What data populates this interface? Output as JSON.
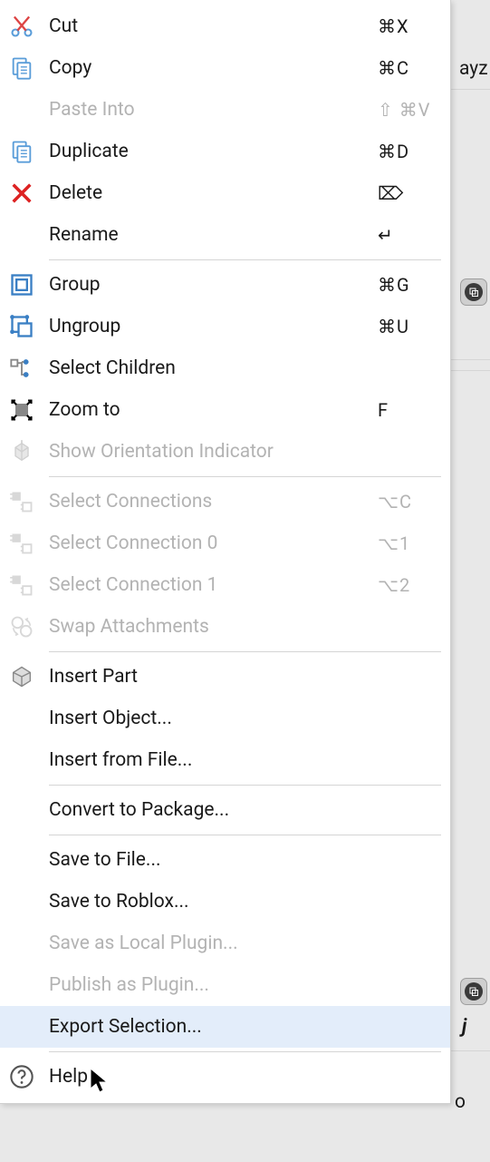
{
  "menu": {
    "groups": [
      [
        {
          "id": "cut",
          "label": "Cut",
          "shortcut": "⌘X",
          "icon": "cut-icon",
          "enabled": true
        },
        {
          "id": "copy",
          "label": "Copy",
          "shortcut": "⌘C",
          "icon": "copy-icon",
          "enabled": true
        },
        {
          "id": "paste-into",
          "label": "Paste Into",
          "shortcut": "⇧ ⌘V",
          "icon": "",
          "enabled": false
        },
        {
          "id": "duplicate",
          "label": "Duplicate",
          "shortcut": "⌘D",
          "icon": "copy-icon",
          "enabled": true
        },
        {
          "id": "delete",
          "label": "Delete",
          "shortcut": "⌦",
          "icon": "delete-icon",
          "enabled": true
        },
        {
          "id": "rename",
          "label": "Rename",
          "shortcut": "↵",
          "icon": "",
          "enabled": true
        }
      ],
      [
        {
          "id": "group",
          "label": "Group",
          "shortcut": "⌘G",
          "icon": "group-icon",
          "enabled": true
        },
        {
          "id": "ungroup",
          "label": "Ungroup",
          "shortcut": "⌘U",
          "icon": "ungroup-icon",
          "enabled": true
        },
        {
          "id": "select-children",
          "label": "Select Children",
          "shortcut": "",
          "icon": "select-children-icon",
          "enabled": true
        },
        {
          "id": "zoom-to",
          "label": "Zoom to",
          "shortcut": "F",
          "icon": "zoom-icon",
          "enabled": true
        },
        {
          "id": "show-orientation",
          "label": "Show Orientation Indicator",
          "shortcut": "",
          "icon": "orientation-icon",
          "enabled": false
        }
      ],
      [
        {
          "id": "select-connections",
          "label": "Select Connections",
          "shortcut": "⌥C",
          "icon": "connection-icon",
          "enabled": false
        },
        {
          "id": "select-connection-0",
          "label": "Select Connection 0",
          "shortcut": "⌥1",
          "icon": "connection-icon",
          "enabled": false
        },
        {
          "id": "select-connection-1",
          "label": "Select Connection 1",
          "shortcut": "⌥2",
          "icon": "connection-icon",
          "enabled": false
        },
        {
          "id": "swap-attachments",
          "label": "Swap Attachments",
          "shortcut": "",
          "icon": "swap-icon",
          "enabled": false
        }
      ],
      [
        {
          "id": "insert-part",
          "label": "Insert Part",
          "shortcut": "",
          "icon": "part-icon",
          "enabled": true
        },
        {
          "id": "insert-object",
          "label": "Insert Object...",
          "shortcut": "",
          "icon": "",
          "enabled": true
        },
        {
          "id": "insert-from-file",
          "label": "Insert from File...",
          "shortcut": "",
          "icon": "",
          "enabled": true
        }
      ],
      [
        {
          "id": "convert-to-package",
          "label": "Convert to Package...",
          "shortcut": "",
          "icon": "",
          "enabled": true
        }
      ],
      [
        {
          "id": "save-to-file",
          "label": "Save to File...",
          "shortcut": "",
          "icon": "",
          "enabled": true
        },
        {
          "id": "save-to-roblox",
          "label": "Save to Roblox...",
          "shortcut": "",
          "icon": "",
          "enabled": true
        },
        {
          "id": "save-as-local-plugin",
          "label": "Save as Local Plugin...",
          "shortcut": "",
          "icon": "",
          "enabled": false
        },
        {
          "id": "publish-as-plugin",
          "label": "Publish as Plugin...",
          "shortcut": "",
          "icon": "",
          "enabled": false
        },
        {
          "id": "export-selection",
          "label": "Export Selection...",
          "shortcut": "",
          "icon": "",
          "enabled": true,
          "hovered": true
        }
      ],
      [
        {
          "id": "help",
          "label": "Help",
          "shortcut": "",
          "icon": "help-icon",
          "enabled": true
        }
      ]
    ]
  },
  "background": {
    "text1": "ayz",
    "text2": "j",
    "text3": "o"
  }
}
